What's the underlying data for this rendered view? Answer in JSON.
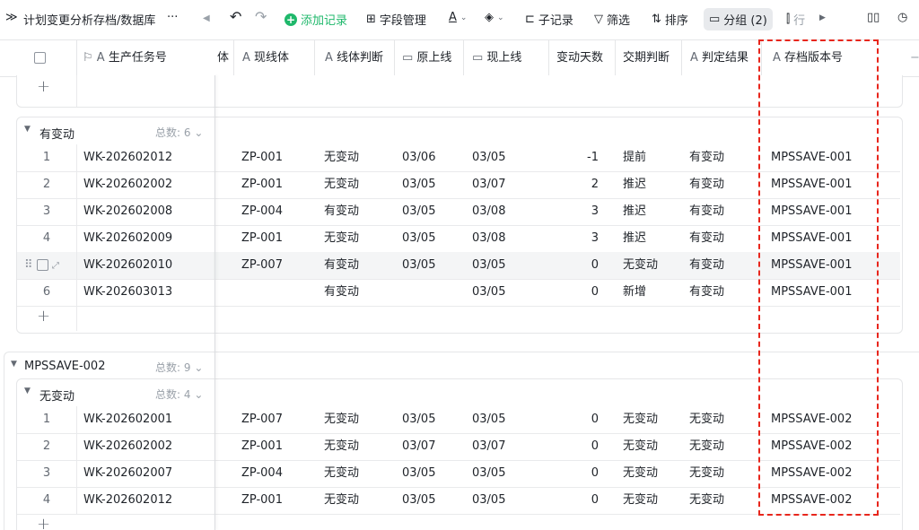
{
  "toolbar": {
    "breadcrumb": "计划变更分析存档/数据库",
    "more": "···",
    "add_record": "添加记录",
    "fields": "字段管理",
    "sub_record": "子记录",
    "filter": "筛选",
    "sort": "排序",
    "group": "分组 (2)",
    "row_height": "行"
  },
  "columns": {
    "task": "生产任务号",
    "partial": "体",
    "cur_line": "现线体",
    "line_judge": "线体判断",
    "orig_date": "原上线",
    "cur_date": "现上线",
    "delta": "变动天数",
    "delivery": "交期判断",
    "result": "判定结果",
    "version": "存档版本号"
  },
  "groups": {
    "g1": {
      "name": "有变动",
      "count": "总数: 6"
    },
    "g2": {
      "name": "MPSSAVE-002",
      "count": "总数: 9"
    },
    "g3": {
      "name": "无变动",
      "count": "总数: 4"
    }
  },
  "changed_rows": [
    {
      "n": "1",
      "task": "WK-202602012",
      "line": "ZP-001",
      "judge": "无变动",
      "orig": "03/06",
      "cur": "03/05",
      "delta": "-1",
      "delivery": "提前",
      "result": "有变动",
      "version": "MPSSAVE-001"
    },
    {
      "n": "2",
      "task": "WK-202602002",
      "line": "ZP-001",
      "judge": "无变动",
      "orig": "03/05",
      "cur": "03/07",
      "delta": "2",
      "delivery": "推迟",
      "result": "有变动",
      "version": "MPSSAVE-001"
    },
    {
      "n": "3",
      "task": "WK-202602008",
      "line": "ZP-004",
      "judge": "有变动",
      "orig": "03/05",
      "cur": "03/08",
      "delta": "3",
      "delivery": "推迟",
      "result": "有变动",
      "version": "MPSSAVE-001"
    },
    {
      "n": "4",
      "task": "WK-202602009",
      "line": "ZP-001",
      "judge": "无变动",
      "orig": "03/05",
      "cur": "03/08",
      "delta": "3",
      "delivery": "推迟",
      "result": "有变动",
      "version": "MPSSAVE-001"
    },
    {
      "n": "",
      "task": "WK-202602010",
      "line": "ZP-007",
      "judge": "有变动",
      "orig": "03/05",
      "cur": "03/05",
      "delta": "0",
      "delivery": "无变动",
      "result": "有变动",
      "version": "MPSSAVE-001"
    },
    {
      "n": "6",
      "task": "WK-202603013",
      "line": "",
      "judge": "有变动",
      "orig": "",
      "cur": "03/05",
      "delta": "0",
      "delivery": "新增",
      "result": "有变动",
      "version": "MPSSAVE-001"
    }
  ],
  "unchanged_rows": [
    {
      "n": "1",
      "task": "WK-202602001",
      "line": "ZP-007",
      "judge": "无变动",
      "orig": "03/05",
      "cur": "03/05",
      "delta": "0",
      "delivery": "无变动",
      "result": "无变动",
      "version": "MPSSAVE-002"
    },
    {
      "n": "2",
      "task": "WK-202602002",
      "line": "ZP-001",
      "judge": "无变动",
      "orig": "03/07",
      "cur": "03/07",
      "delta": "0",
      "delivery": "无变动",
      "result": "无变动",
      "version": "MPSSAVE-002"
    },
    {
      "n": "3",
      "task": "WK-202602007",
      "line": "ZP-004",
      "judge": "无变动",
      "orig": "03/05",
      "cur": "03/05",
      "delta": "0",
      "delivery": "无变动",
      "result": "无变动",
      "version": "MPSSAVE-002"
    },
    {
      "n": "4",
      "task": "WK-202602012",
      "line": "ZP-001",
      "judge": "无变动",
      "orig": "03/05",
      "cur": "03/05",
      "delta": "0",
      "delivery": "无变动",
      "result": "无变动",
      "version": "MPSSAVE-002"
    }
  ]
}
